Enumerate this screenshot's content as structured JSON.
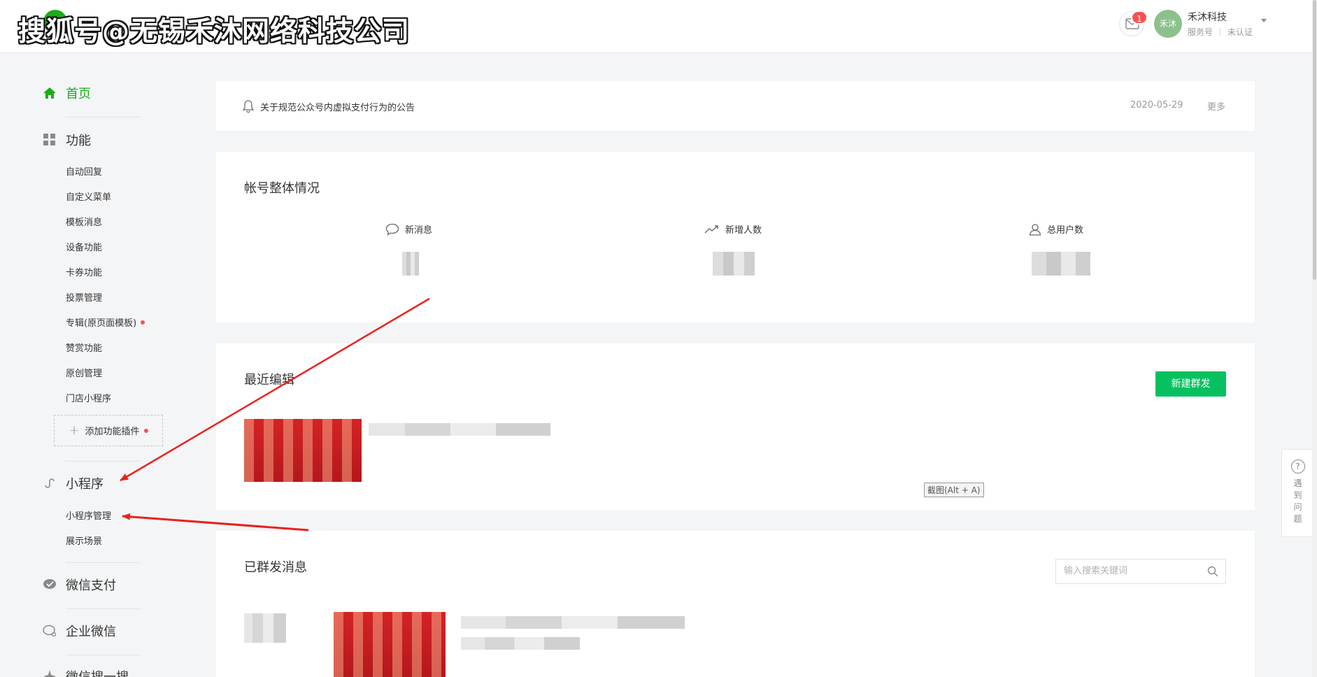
{
  "watermark": "搜狐号@无锡禾沐网络科技公司",
  "header": {
    "mail_badge": "1",
    "avatar_text": "禾沐",
    "account_name": "禾沐科技",
    "account_type": "服务号",
    "account_status": "未认证"
  },
  "sidebar": {
    "home": "首页",
    "functions": {
      "label": "功能",
      "items": [
        "自动回复",
        "自定义菜单",
        "模板消息",
        "设备功能",
        "卡券功能",
        "投票管理",
        "专辑(原页面模板)",
        "赞赏功能",
        "原创管理",
        "门店小程序"
      ],
      "add_plugin": "添加功能插件"
    },
    "miniprogram": {
      "label": "小程序",
      "items": [
        "小程序管理",
        "展示场景"
      ]
    },
    "wechat_pay": "微信支付",
    "wecom": "企业微信",
    "more_partial": "微信搜一搜"
  },
  "notice": {
    "text": "关于规范公众号内虚拟支付行为的公告",
    "date": "2020-05-29",
    "more": "更多"
  },
  "overview": {
    "title": "帐号整体情况",
    "stats": [
      {
        "label": "新消息",
        "icon": "chat-bubble-icon"
      },
      {
        "label": "新增人数",
        "icon": "trend-up-icon"
      },
      {
        "label": "总用户数",
        "icon": "user-icon"
      }
    ]
  },
  "recent": {
    "title": "最近编辑",
    "new_broadcast": "新建群发",
    "screenshot_hint": "截图(Alt + A)"
  },
  "sent": {
    "title": "已群发消息",
    "search_placeholder": "输入搜索关键词"
  },
  "feedback": {
    "icon": "?",
    "text": "遇到问题"
  },
  "colors": {
    "brand_green": "#07c160",
    "nav_active": "#1aad19",
    "badge_red": "#fa5151",
    "annotation_red": "#e8231e"
  }
}
